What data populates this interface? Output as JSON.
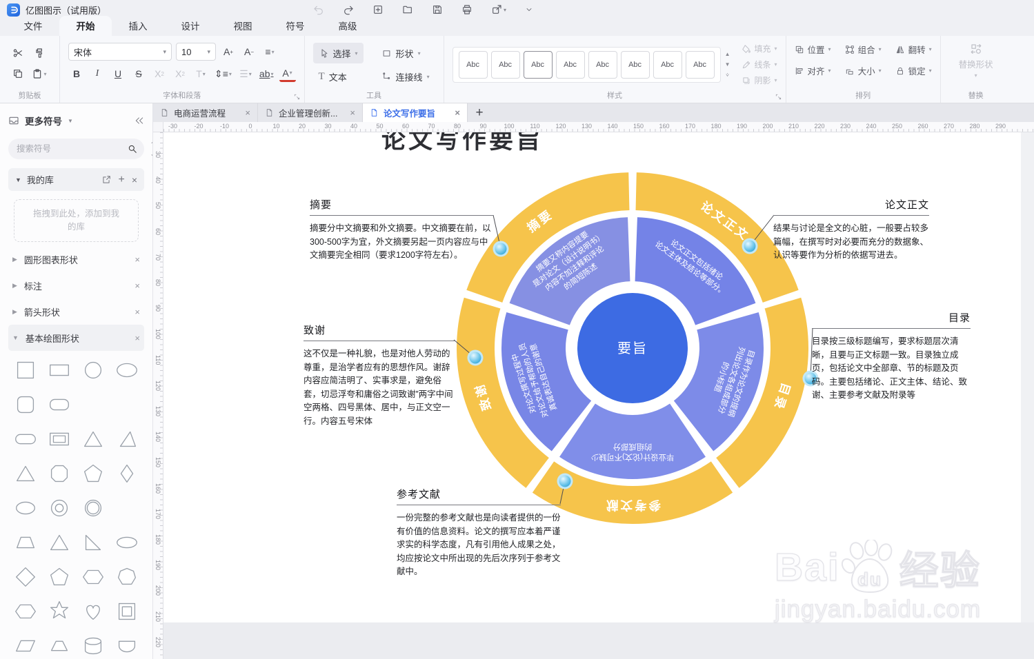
{
  "titlebar": {
    "app_title": "亿图图示（试用版）",
    "buttons": [
      {
        "name": "undo",
        "disabled": true
      },
      {
        "name": "redo",
        "disabled": false
      },
      {
        "name": "new",
        "disabled": false
      },
      {
        "name": "open",
        "disabled": false
      },
      {
        "name": "save",
        "disabled": false
      },
      {
        "name": "print",
        "disabled": false
      },
      {
        "name": "share",
        "disabled": false,
        "caret": true
      },
      {
        "name": "collapse-toolbar",
        "disabled": false
      }
    ]
  },
  "menubar": {
    "tabs": [
      "文件",
      "开始",
      "插入",
      "设计",
      "视图",
      "符号",
      "高级"
    ],
    "active_tab": "开始"
  },
  "ribbon": {
    "clipboard": {
      "label": "剪贴板"
    },
    "font": {
      "label": "字体和段落",
      "font_name": "宋体",
      "font_size": "10"
    },
    "tools": {
      "label": "工具",
      "select": "选择",
      "shape": "形状",
      "text": "文本",
      "connector": "连接线"
    },
    "styles": {
      "label": "样式",
      "sample": "Abc",
      "count": 8,
      "selected_index": 2,
      "side_buttons": [
        {
          "label": "填充",
          "icon": "fill"
        },
        {
          "label": "线条",
          "icon": "pen"
        },
        {
          "label": "阴影",
          "icon": "shadow"
        }
      ]
    },
    "arrange": {
      "label": "排列",
      "items": [
        {
          "label": "位置",
          "icon": "position"
        },
        {
          "label": "组合",
          "icon": "group"
        },
        {
          "label": "翻转",
          "icon": "flip"
        },
        {
          "label": "对齐",
          "icon": "align"
        },
        {
          "label": "大小",
          "icon": "size"
        },
        {
          "label": "锁定",
          "icon": "lock"
        }
      ]
    },
    "replace": {
      "label": "替换",
      "button": "替换形状"
    }
  },
  "sidebar": {
    "header": "更多符号",
    "search_placeholder": "搜索符号",
    "my_library": {
      "label": "我的库",
      "drop_hint": "拖拽到此处，添加到我的库"
    },
    "sections": [
      {
        "label": "圆形图表形状",
        "expanded": false
      },
      {
        "label": "标注",
        "expanded": false
      },
      {
        "label": "箭头形状",
        "expanded": false
      },
      {
        "label": "基本绘图形状",
        "expanded": true
      }
    ],
    "shapes": [
      "square",
      "rect",
      "circle",
      "ellipse",
      "rounded-square",
      "rounded-rect",
      "",
      "",
      "stadium",
      "frame-rect",
      "triangle",
      "acute-triangle",
      "triangle",
      "octagon",
      "pentagon",
      "diamond-thin",
      "oval",
      "donut",
      "double-circle",
      "",
      "trapezoid",
      "triangle",
      "right-triangle",
      "oval-wide",
      "diamond",
      "pentagon",
      "hexagon",
      "heptagon",
      "hexagon",
      "star",
      "heart",
      "framed-square",
      "parallelogram",
      "trapezoid-narrow",
      "cylinder",
      "half-stadium"
    ]
  },
  "document_tabs": {
    "tabs": [
      {
        "label": "电商运营流程",
        "active": false
      },
      {
        "label": "企业管理创新...",
        "active": false
      },
      {
        "label": "论文写作要旨",
        "active": true
      }
    ]
  },
  "rulers": {
    "horizontal_start": -30,
    "horizontal_end": 290,
    "vertical_start": 30,
    "vertical_end": 220,
    "step": 10
  },
  "canvas": {
    "page_title": "论文写作要旨",
    "watermark": {
      "brand": "Bai",
      "brand2": "经验",
      "paw_text": "du",
      "url": "jingyan.baidu.com"
    },
    "chart_data": {
      "type": "ring-diagram",
      "center_label": "要旨",
      "colors": {
        "outer_ring": "#F6C44B",
        "center": "#3D6BE3",
        "callout_dot": "#2FA6DA"
      },
      "segments": [
        {
          "label": "论文正文",
          "start_angle": 0,
          "end_angle": 72,
          "inner_color": "#7483E7",
          "inner_lines": [
            "论文正文包括绪论",
            "论文主体及结论等部分。"
          ],
          "annotation": {
            "title": "论文正文",
            "body": "结果与讨论是全文的心脏，一般要占较多篇幅，在撰写时对必要而充分的数据象、认识等要作为分析的依据写进去。"
          }
        },
        {
          "label": "目录",
          "start_angle": 72,
          "end_angle": 144,
          "inner_color": "#7D8BE8",
          "inner_lines": [
            "目录作为论文的提纲",
            "列出论文各组成部分",
            "的小标题"
          ],
          "annotation": {
            "title": "目录",
            "body": "目录按三级标题编写，要求标题层次清晰，且要与正文标题一致。目录独立成页，包括论文中全部章、节的标题及页码。主要包括绪论、正文主体、结论、致谢、主要参考文献及附录等"
          }
        },
        {
          "label": "参考文献",
          "start_angle": 144,
          "end_angle": 216,
          "inner_color": "#808EE9",
          "inner_lines": [
            "毕业设计(论文)不可缺少",
            "的组成部分"
          ],
          "annotation": {
            "title": "参考文献",
            "body": "一份完整的参考文献也是向读者提供的一份有价值的信息资料。论文的撰写应本着严谨求实的科学态度，凡有引用他人成果之处，均应按论文中所出现的先后次序列于参考文献中。"
          }
        },
        {
          "label": "致谢",
          "start_angle": 216,
          "end_angle": 288,
          "inner_color": "#7886E6",
          "inner_lines": [
            "对论文撰写过程中",
            "对论文给予帮助的人员",
            "真诚表达自己的谢意"
          ],
          "annotation": {
            "title": "致谢",
            "body": "这不仅是一种礼貌，也是对他人劳动的尊重，是治学者应有的思想作风。谢辞内容应简洁明了、实事求是，避免俗套，切忌浮夸和庸俗之词致谢”两字中间空两格、四号黑体、居中，与正文空一行。内容五号宋体"
          }
        },
        {
          "label": "摘要",
          "start_angle": 288,
          "end_angle": 360,
          "inner_color": "#8690E3",
          "inner_lines": [
            "摘要又称内容提要",
            "是对论文（设计说明书）",
            "内容不加注释和评论",
            "的简短陈述"
          ],
          "annotation": {
            "title": "摘要",
            "body": "摘要分中文摘要和外文摘要。中文摘要在前，以300-500字为宜，外文摘要另起一页内容应与中文摘要完全相同（要求1200字符左右）。"
          }
        }
      ]
    }
  }
}
